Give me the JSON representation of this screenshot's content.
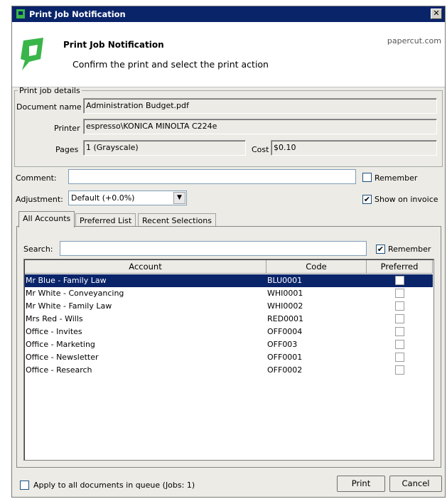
{
  "window": {
    "title": "Print Job Notification"
  },
  "header": {
    "title": "Print Job Notification",
    "subtitle": "Confirm the print and select the print action",
    "brand": "papercut.com"
  },
  "details": {
    "legend": "Print job details",
    "document_label": "Document name",
    "document_value": "Administration Budget.pdf",
    "printer_label": "Printer",
    "printer_value": "espresso\\KONICA MINOLTA C224e",
    "pages_label": "Pages",
    "pages_value": "1   (Grayscale)",
    "cost_label": "Cost",
    "cost_value": "$0.10"
  },
  "comment": {
    "label": "Comment:",
    "value": "",
    "remember_label": "Remember",
    "remember_checked": false
  },
  "adjustment": {
    "label": "Adjustment:",
    "value": "Default (+0.0%)",
    "invoice_label": "Show on invoice",
    "invoice_checked": true
  },
  "tabs": [
    {
      "label": "All Accounts",
      "active": true
    },
    {
      "label": "Preferred List",
      "active": false
    },
    {
      "label": "Recent Selections",
      "active": false
    }
  ],
  "search": {
    "label": "Search:",
    "value": "",
    "remember_label": "Remember",
    "remember_checked": true
  },
  "table": {
    "columns": [
      "Account",
      "Code",
      "Preferred"
    ],
    "rows": [
      {
        "account": "Mr Blue - Family Law",
        "code": "BLU0001",
        "preferred": false,
        "selected": true
      },
      {
        "account": "Mr White - Conveyancing",
        "code": "WHI0001",
        "preferred": false,
        "selected": false
      },
      {
        "account": "Mr White - Family Law",
        "code": "WHI0002",
        "preferred": false,
        "selected": false
      },
      {
        "account": "Mrs Red - Wills",
        "code": "RED0001",
        "preferred": false,
        "selected": false
      },
      {
        "account": "Office - Invites",
        "code": "OFF0004",
        "preferred": false,
        "selected": false
      },
      {
        "account": "Office - Marketing",
        "code": "OFF003",
        "preferred": false,
        "selected": false
      },
      {
        "account": "Office - Newsletter",
        "code": "OFF0001",
        "preferred": false,
        "selected": false
      },
      {
        "account": "Office - Research",
        "code": "OFF0002",
        "preferred": false,
        "selected": false
      }
    ]
  },
  "footer": {
    "apply_label": "Apply to all documents in queue (Jobs: 1)",
    "apply_checked": false,
    "print_label": "Print",
    "cancel_label": "Cancel"
  },
  "colors": {
    "titlebar": "#0a246a",
    "selection": "#0a246a",
    "logo_green": "#3ab54a"
  }
}
